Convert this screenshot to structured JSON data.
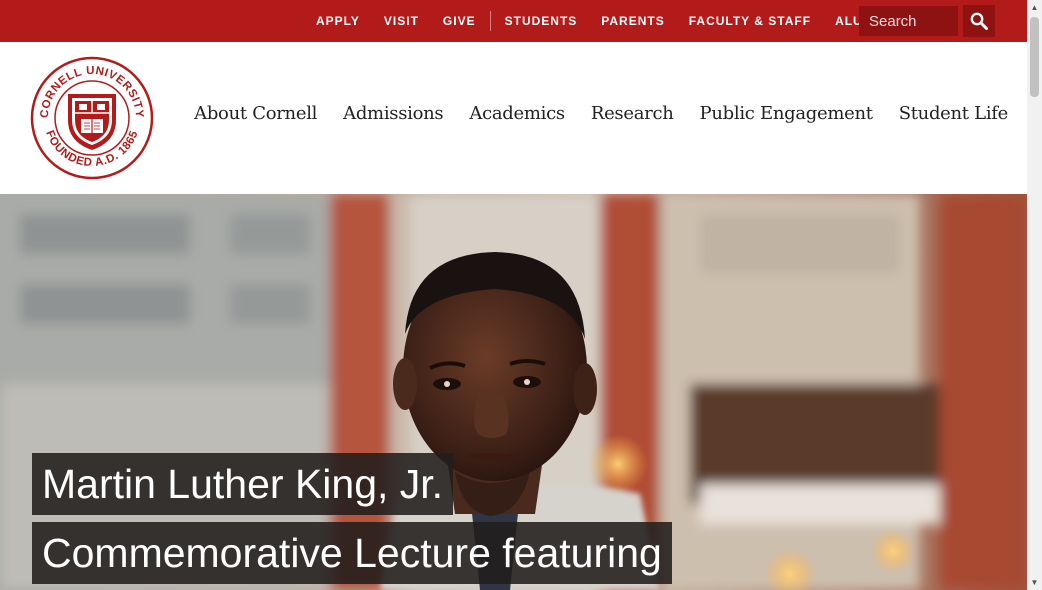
{
  "utility_nav": {
    "links": [
      "APPLY",
      "VISIT",
      "GIVE"
    ],
    "audience_links": [
      "STUDENTS",
      "PARENTS",
      "FACULTY & STAFF",
      "ALUMNI"
    ]
  },
  "search": {
    "placeholder": "Search",
    "icon": "search-icon"
  },
  "logo": {
    "ring_text_top": "CORNELL UNIVERSITY",
    "ring_text_bottom": "FOUNDED A.D. 1865",
    "icon": "cornell-seal"
  },
  "main_nav": {
    "items": [
      "About Cornell",
      "Admissions",
      "Academics",
      "Research",
      "Public Engagement",
      "Student Life"
    ]
  },
  "hero": {
    "headline_line_1": "Martin Luther King, Jr.",
    "headline_line_2": "Commemorative Lecture featuring"
  },
  "colors": {
    "brand_red": "#b31b1b",
    "dark_red": "#8f1212",
    "headline_bg": "#221e1c"
  }
}
